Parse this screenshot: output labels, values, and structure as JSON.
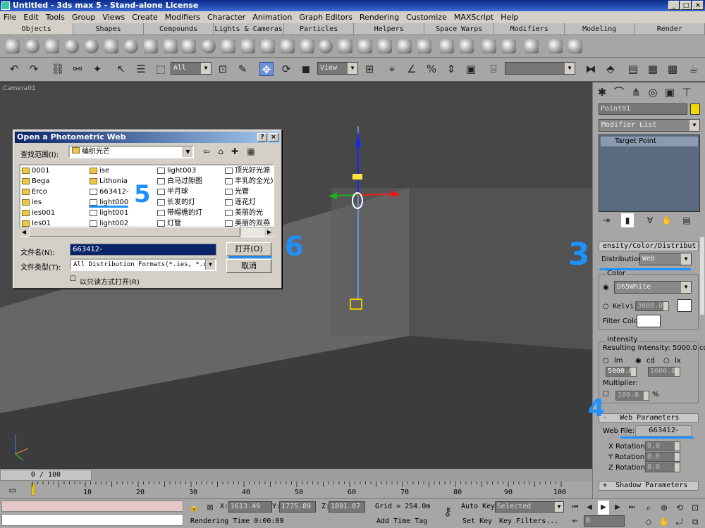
{
  "title": "Untitled - 3ds max 5 - Stand-alone License",
  "window_buttons": [
    "_",
    "□",
    "×"
  ],
  "menu": [
    "File",
    "Edit",
    "Tools",
    "Group",
    "Views",
    "Create",
    "Modifiers",
    "Character",
    "Animation",
    "Graph Editors",
    "Rendering",
    "Customize",
    "MAXScript",
    "Help"
  ],
  "tabs": [
    "Objects",
    "Shapes",
    "Compounds",
    "Lights & Cameras",
    "Particles",
    "Helpers",
    "Space Warps",
    "Modifiers",
    "Modeling",
    "Render"
  ],
  "toolbar": {
    "selection_filter": "All",
    "coord_system": "View"
  },
  "viewport": {
    "label": "Camera01"
  },
  "dialog": {
    "title": "Open a Photometric Web",
    "help_btn": "?",
    "close_btn": "×",
    "look_in_label": "查找范围(I):",
    "look_in_value": "编织光芒",
    "files": [
      {
        "name": "0001",
        "type": "folder"
      },
      {
        "name": "Bega",
        "type": "folder"
      },
      {
        "name": "Erco",
        "type": "folder"
      },
      {
        "name": "ies",
        "type": "folder"
      },
      {
        "name": "ies001",
        "type": "folder"
      },
      {
        "name": "Ies01",
        "type": "folder"
      },
      {
        "name": "ise",
        "type": "folder"
      },
      {
        "name": "Lithonia",
        "type": "folder"
      },
      {
        "name": "663412-",
        "type": "file"
      },
      {
        "name": "light000",
        "type": "file"
      },
      {
        "name": "light001",
        "type": "file"
      },
      {
        "name": "light002",
        "type": "file"
      },
      {
        "name": "light003",
        "type": "file"
      },
      {
        "name": "白马过隙图",
        "type": "file"
      },
      {
        "name": "半月球",
        "type": "file"
      },
      {
        "name": "长发的灯",
        "type": "file"
      },
      {
        "name": "带帽檐的灯",
        "type": "file"
      },
      {
        "name": "灯管",
        "type": "file"
      },
      {
        "name": "顶光好光源",
        "type": "file"
      },
      {
        "name": "丰乳的全光光",
        "type": "file"
      },
      {
        "name": "光管",
        "type": "file"
      },
      {
        "name": "莲花灯",
        "type": "file"
      },
      {
        "name": "美丽的光",
        "type": "file"
      },
      {
        "name": "美丽的双燕",
        "type": "file"
      }
    ],
    "filename_label": "文件名(N):",
    "filename_value": "663412-",
    "filetype_label": "文件类型(T):",
    "filetype_value": "All Distribution Formats(*.ies, *.ci",
    "open_btn": "打开(O)",
    "cancel_btn": "取消",
    "readonly_label": "以只读方式打开(R)"
  },
  "annotations": [
    "5",
    "6",
    "3",
    "4"
  ],
  "panel": {
    "object_name": "Point01",
    "object_color": "#f0d800",
    "modifier_list": "Modifier List",
    "stack_item": "Target Point",
    "intensity_rollout": "ensity/Color/Distribut",
    "distribution_label": "Distribution:",
    "distribution_value": "Web",
    "color_group": "Color",
    "color_preset": "D65White",
    "kelvin_label": "Kelvi",
    "kelvin_value": "3600.0",
    "filter_label": "Filter Color:",
    "intensity_group": "Intensity",
    "resulting": "Resulting Intensity: 5000.0 cd",
    "units": [
      "lm",
      "cd",
      "lx"
    ],
    "intensity_value": "5000.0",
    "lx_value": "1000.0",
    "multiplier_label": "Multiplier:",
    "multiplier_value": "100.0",
    "percent": "%",
    "web_rollout": "Web Parameters",
    "web_rollout_sign": "-",
    "web_file_label": "Web File:",
    "web_file_value": "663412-",
    "x_rot_label": "X Rotation:",
    "y_rot_label": "Y Rotation:",
    "z_rot_label": "Z Rotation:",
    "x_rot": "0.0",
    "y_rot": "0.0",
    "z_rot": "0.0",
    "shadow_rollout": "Shadow Parameters",
    "shadow_rollout_sign": "+"
  },
  "timeline": {
    "frame": "0 / 100",
    "ticks": [
      "0",
      "10",
      "20",
      "30",
      "40",
      "50",
      "60",
      "70",
      "80",
      "90",
      "100"
    ]
  },
  "status": {
    "x_label": "X:",
    "x": "1613.49",
    "y_label": "Y:",
    "y": "1775.89",
    "z_label": "Z:",
    "z": "1891.87",
    "grid": "Grid = 254.0m",
    "auto_key": "Auto Key",
    "set_key": "Set Key",
    "selected": "Selected",
    "key_filters": "Key Filters...",
    "rendering_time": "Rendering Time  0:00:09",
    "add_time_tag": "Add Time Tag",
    "frame": "0"
  }
}
